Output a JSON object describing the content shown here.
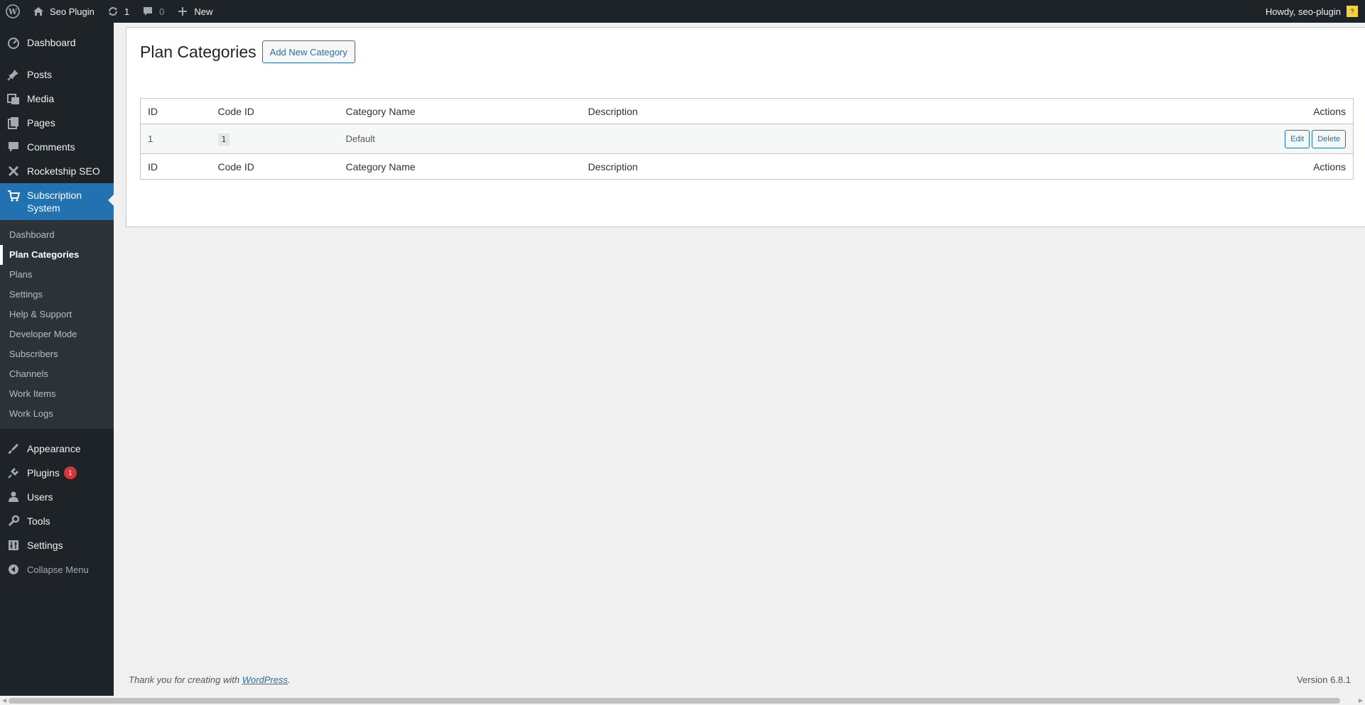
{
  "adminbar": {
    "site_name": "Seo Plugin",
    "updates_count": "1",
    "comments_count": "0",
    "new_label": "New",
    "greeting": "Howdy, seo-plugin"
  },
  "sidebar": {
    "items": [
      {
        "label": "Dashboard",
        "icon": "dashboard-icon"
      },
      {
        "label": "Posts",
        "icon": "pin-icon"
      },
      {
        "label": "Media",
        "icon": "media-icon"
      },
      {
        "label": "Pages",
        "icon": "pages-icon"
      },
      {
        "label": "Comments",
        "icon": "comments-icon"
      },
      {
        "label": "Rocketship SEO",
        "icon": "rocket-icon"
      },
      {
        "label": "Subscription System",
        "icon": "cart-icon"
      }
    ],
    "submenu": [
      "Dashboard",
      "Plan Categories",
      "Plans",
      "Settings",
      "Help & Support",
      "Developer Mode",
      "Subscribers",
      "Channels",
      "Work Items",
      "Work Logs"
    ],
    "lower_items": [
      {
        "label": "Appearance",
        "icon": "appearance-icon"
      },
      {
        "label": "Plugins",
        "icon": "plugins-icon",
        "badge": "1"
      },
      {
        "label": "Users",
        "icon": "users-icon"
      },
      {
        "label": "Tools",
        "icon": "tools-icon"
      },
      {
        "label": "Settings",
        "icon": "settings-icon"
      }
    ],
    "collapse_label": "Collapse Menu"
  },
  "page": {
    "title": "Plan Categories",
    "add_button": "Add New Category"
  },
  "table": {
    "columns": [
      "ID",
      "Code ID",
      "Category Name",
      "Description",
      "Actions"
    ],
    "rows": [
      {
        "id": "1",
        "code_id": "1",
        "name": "Default",
        "description": "",
        "edit": "Edit",
        "delete": "Delete"
      }
    ]
  },
  "footer": {
    "thanks_prefix": "Thank you for creating with ",
    "thanks_link": "WordPress",
    "thanks_suffix": ".",
    "version": "Version 6.8.1"
  },
  "colors": {
    "accent": "#2271b1",
    "sidebar_bg": "#1d2327",
    "submenu_bg": "#2c3338",
    "badge": "#d63638"
  }
}
